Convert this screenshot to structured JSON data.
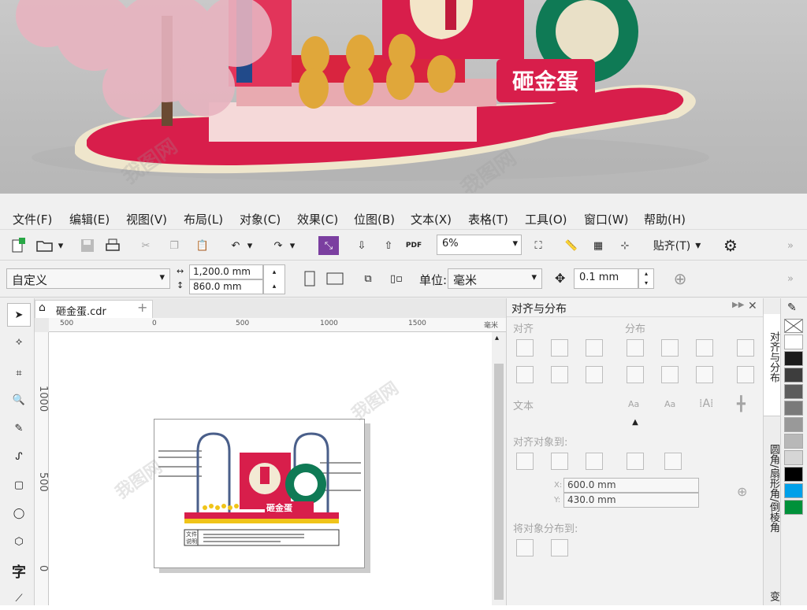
{
  "render": {
    "sign_text": "砸金蛋"
  },
  "menu": [
    {
      "label": "文件(F)"
    },
    {
      "label": "编辑(E)"
    },
    {
      "label": "视图(V)"
    },
    {
      "label": "布局(L)"
    },
    {
      "label": "对象(C)"
    },
    {
      "label": "效果(C)"
    },
    {
      "label": "位图(B)"
    },
    {
      "label": "文本(X)"
    },
    {
      "label": "表格(T)"
    },
    {
      "label": "工具(O)"
    },
    {
      "label": "窗口(W)"
    },
    {
      "label": "帮助(H)"
    }
  ],
  "toolbar": {
    "zoom": "6%",
    "snap_label": "贴齐(T)",
    "pdf_label": "PDF"
  },
  "propbar": {
    "page_size": "自定义",
    "width": "1,200.0 mm",
    "height": "860.0 mm",
    "unit_label": "单位:",
    "unit_value": "毫米",
    "nudge": "0.1 mm"
  },
  "document": {
    "tab_name": "砸金蛋.cdr"
  },
  "ruler": {
    "h_ticks": [
      "500",
      "0",
      "500",
      "1000",
      "1500"
    ],
    "v_ticks": [
      "1000",
      "500",
      "0"
    ],
    "unit": "毫米"
  },
  "artwork": {
    "sign_text": "砸金蛋",
    "label_line1": "文件",
    "label_line2": "说明"
  },
  "panel": {
    "title": "对齐与分布",
    "align_section": "对齐",
    "distribute_section": "分布",
    "text_section": "文本",
    "align_to_label": "对齐对象到:",
    "x_value": "600.0 mm",
    "y_value": "430.0 mm",
    "x_label": "X:",
    "y_label": "Y:",
    "distribute_to_label": "将对象分布到:",
    "text_icon_label": "Aa"
  },
  "side_tabs": {
    "tab1": "对齐与分布",
    "tab2": "圆角/扇形角/倒棱角",
    "tab3": "变"
  },
  "palette": {
    "colors": [
      "#ffffff",
      "#1a1a1a",
      "#3d3d3d",
      "#5c5c5c",
      "#7a7a7a",
      "#999999",
      "#b8b8b8",
      "#d6d6d6",
      "#000000",
      "#00a0e9",
      "#00913a"
    ]
  }
}
